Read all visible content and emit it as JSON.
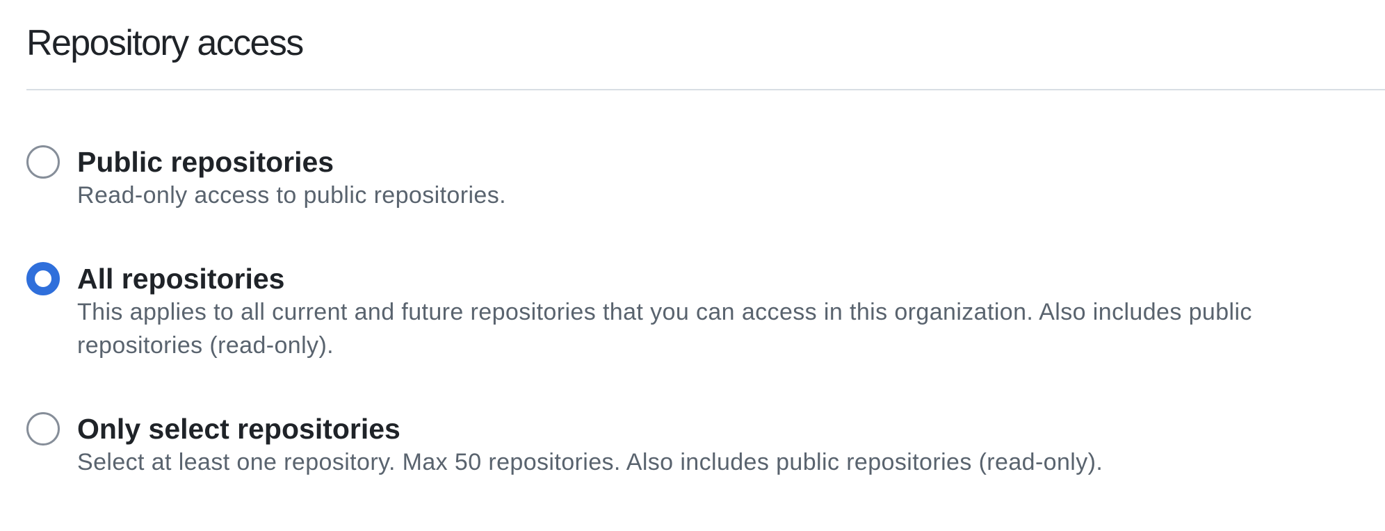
{
  "section": {
    "title": "Repository access"
  },
  "options": [
    {
      "label": "Public repositories",
      "description": "Read-only access to public repositories.",
      "checked": false
    },
    {
      "label": "All repositories",
      "description": "This applies to all current and future repositories that you can access in this organization. Also includes public repositories (read-only).",
      "checked": true
    },
    {
      "label": "Only select repositories",
      "description": "Select at least one repository. Max 50 repositories. Also includes public repositories (read-only).",
      "checked": false
    }
  ],
  "colors": {
    "selected_radio": "#2f6fdb",
    "unselected_radio_border": "#868e99",
    "heading_text": "#1f2328",
    "description_text": "#59636e",
    "divider": "#d8dee4"
  }
}
